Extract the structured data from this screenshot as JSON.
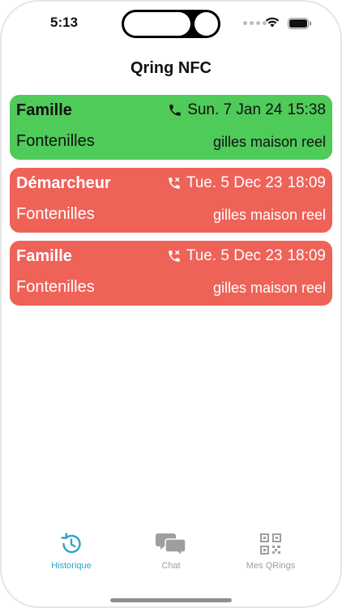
{
  "status_bar": {
    "time": "5:13"
  },
  "header": {
    "title": "Qring NFC"
  },
  "colors": {
    "green": "#4fcb5a",
    "red": "#ee6258",
    "accent": "#2ea2c7",
    "inactive": "#9e9e9e"
  },
  "cards": [
    {
      "title": "Famille",
      "date": "Sun. 7 Jan 24",
      "time": "15:38",
      "location": "Fontenilles",
      "device": "gilles maison reel",
      "call_icon": "phone-icon",
      "color": "green"
    },
    {
      "title": "Démarcheur",
      "date": "Tue. 5 Dec 23",
      "time": "18:09",
      "location": "Fontenilles",
      "device": "gilles maison reel",
      "call_icon": "missed-call-icon",
      "color": "red"
    },
    {
      "title": "Famille",
      "date": "Tue. 5 Dec 23",
      "time": "18:09",
      "location": "Fontenilles",
      "device": "gilles maison reel",
      "call_icon": "missed-call-icon",
      "color": "red"
    }
  ],
  "tabs": [
    {
      "label": "Historique",
      "icon": "history-icon",
      "active": true
    },
    {
      "label": "Chat",
      "icon": "chat-icon",
      "active": false
    },
    {
      "label": "Mes QRings",
      "icon": "qr-code-icon",
      "active": false
    }
  ]
}
